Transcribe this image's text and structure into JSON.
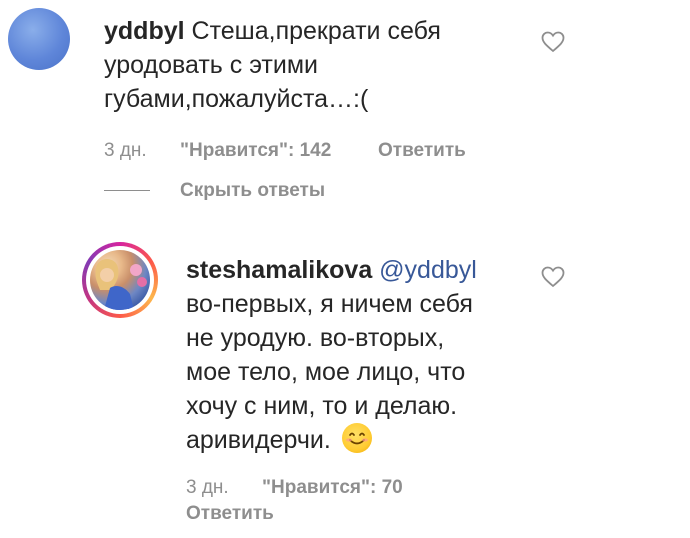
{
  "comments": [
    {
      "username": "yddbyl",
      "text_lines": [
        "Стеша,прекрати себя",
        "уродовать с этими",
        "губами,пожалуйста…:("
      ],
      "time": "3 дн.",
      "likes": "\"Нравится\": 142",
      "reply_label": "Ответить",
      "hide_replies_label": "Скрыть ответы"
    },
    {
      "username": "steshamalikova",
      "mention": "@yddbyl",
      "text_lines": [
        "во-первых, я ничем себя",
        "не уродую. во-вторых,",
        "мое тело, мое лицо, что",
        "хочу с ним, то и делаю.",
        "аривидерчи."
      ],
      "emoji": "smiling-face-emoji",
      "time": "3 дн.",
      "likes": "\"Нравится\": 70",
      "reply_label": "Ответить"
    }
  ],
  "colors": {
    "text": "#262626",
    "meta": "#8e8e8e",
    "mention": "#385898",
    "heart": "#8e8e8e"
  }
}
